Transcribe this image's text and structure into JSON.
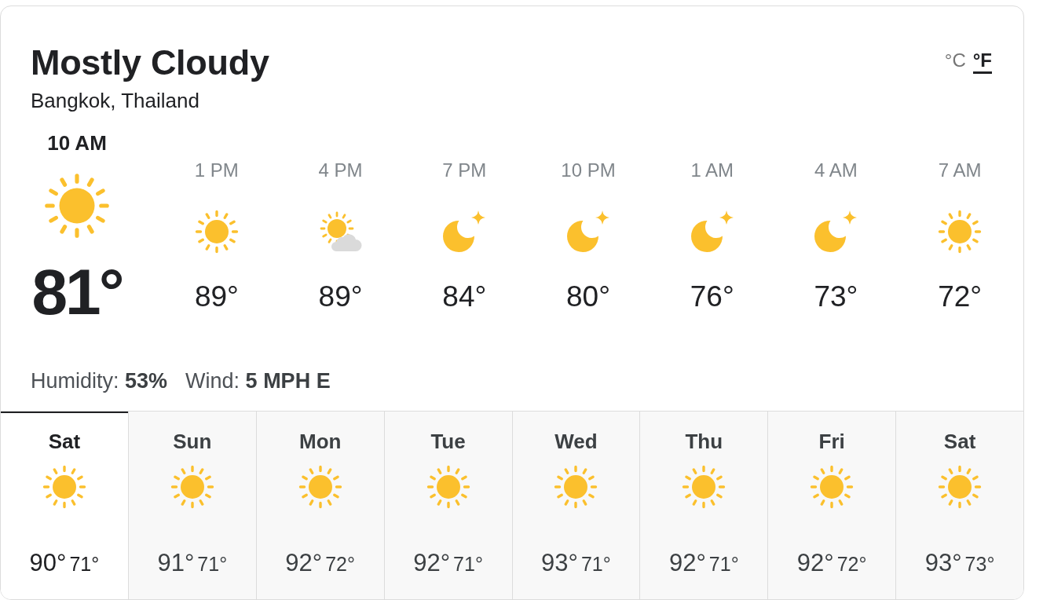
{
  "header": {
    "condition": "Mostly Cloudy",
    "location": "Bangkok, Thailand"
  },
  "units": [
    {
      "label": "°C",
      "selected": false
    },
    {
      "label": "°F",
      "selected": true
    }
  ],
  "now": {
    "time": "10 AM",
    "kind": "sun",
    "temp": "81°"
  },
  "hourly": [
    {
      "time": "1 PM",
      "kind": "sun",
      "temp": "89°"
    },
    {
      "time": "4 PM",
      "kind": "sun-cloud",
      "temp": "89°"
    },
    {
      "time": "7 PM",
      "kind": "moon",
      "temp": "84°"
    },
    {
      "time": "10 PM",
      "kind": "moon",
      "temp": "80°"
    },
    {
      "time": "1 AM",
      "kind": "moon",
      "temp": "76°"
    },
    {
      "time": "4 AM",
      "kind": "moon",
      "temp": "73°"
    },
    {
      "time": "7 AM",
      "kind": "sun",
      "temp": "72°"
    }
  ],
  "details": [
    "Humidity: **53%**",
    "Wind: **5 MPH E**"
  ],
  "daily": [
    {
      "day": "Sat",
      "kind": "sun",
      "high": "90°",
      "low": "71°",
      "selected": true
    },
    {
      "day": "Sun",
      "kind": "sun",
      "high": "91°",
      "low": "71°",
      "selected": false
    },
    {
      "day": "Mon",
      "kind": "sun",
      "high": "92°",
      "low": "72°",
      "selected": false
    },
    {
      "day": "Tue",
      "kind": "sun",
      "high": "92°",
      "low": "71°",
      "selected": false
    },
    {
      "day": "Wed",
      "kind": "sun",
      "high": "93°",
      "low": "71°",
      "selected": false
    },
    {
      "day": "Thu",
      "kind": "sun",
      "high": "92°",
      "low": "71°",
      "selected": false
    },
    {
      "day": "Fri",
      "kind": "sun",
      "high": "92°",
      "low": "72°",
      "selected": false
    },
    {
      "day": "Sat",
      "kind": "sun",
      "high": "93°",
      "low": "73°",
      "selected": false
    }
  ]
}
